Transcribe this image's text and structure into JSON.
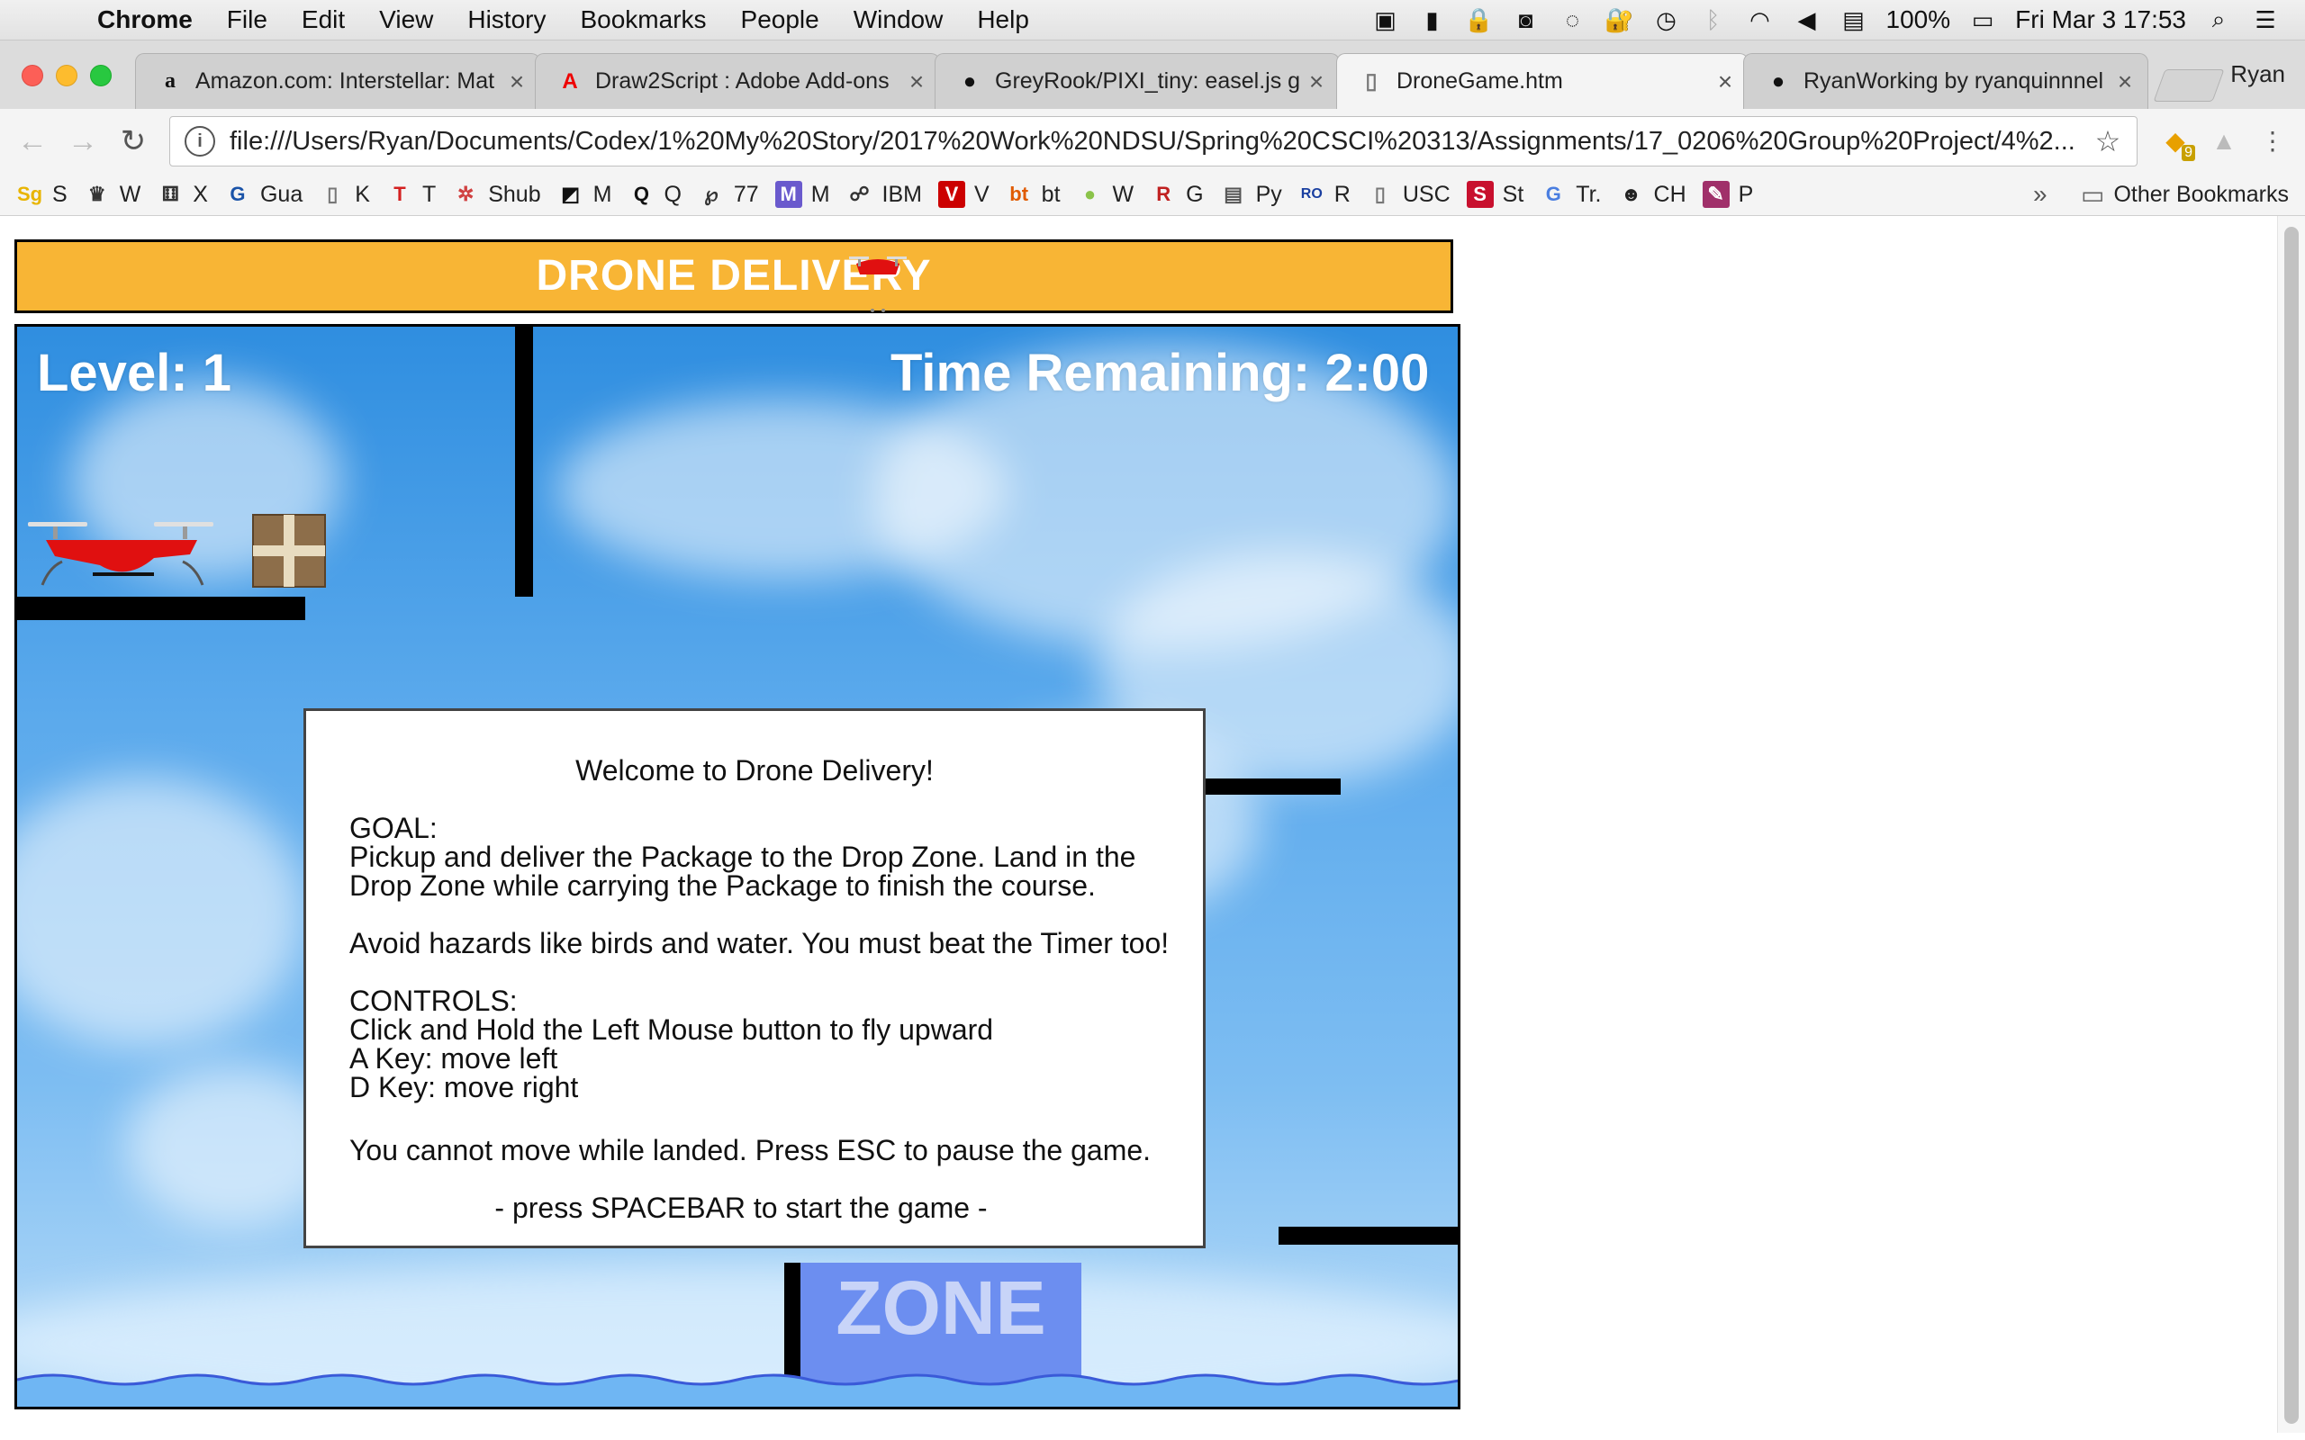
{
  "menubar": {
    "app": "Chrome",
    "items": [
      "File",
      "Edit",
      "View",
      "History",
      "Bookmarks",
      "People",
      "Window",
      "Help"
    ],
    "battery": "100%",
    "datetime": "Fri Mar 3  17:53"
  },
  "tabs": [
    {
      "title": "Amazon.com: Interstellar: Mat",
      "favicon": "amazon-icon",
      "active": false
    },
    {
      "title": "Draw2Script : Adobe Add-ons",
      "favicon": "adobe-icon",
      "active": false
    },
    {
      "title": "GreyRook/PIXI_tiny: easel.js g",
      "favicon": "github-icon",
      "active": false
    },
    {
      "title": "DroneGame.htm",
      "favicon": "page-icon",
      "active": true
    },
    {
      "title": "RyanWorking by ryanquinnnel",
      "favicon": "github-icon",
      "active": false
    }
  ],
  "profile": "Ryan",
  "toolbar": {
    "url": "file:///Users/Ryan/Documents/Codex/1%20My%20Story/2017%20Work%20NDSU/Spring%20CSCI%20313/Assignments/17_0206%20Group%20Project/4%2...",
    "extension_badge": "9"
  },
  "bookmarks": [
    {
      "icon": "Sg",
      "label": "S",
      "color": "#e8b400"
    },
    {
      "icon": "♛",
      "label": "W",
      "color": "#333"
    },
    {
      "icon": "⚅",
      "label": "X",
      "color": "#333"
    },
    {
      "icon": "G",
      "label": "Gua",
      "color": "#1a53a8"
    },
    {
      "icon": "▯",
      "label": "K",
      "color": "#777"
    },
    {
      "icon": "T",
      "label": "T",
      "color": "#d42020"
    },
    {
      "icon": "✲",
      "label": "Shub",
      "color": "#d04040"
    },
    {
      "icon": "◩",
      "label": "M",
      "color": "#111"
    },
    {
      "icon": "Q",
      "label": "Q",
      "color": "#111"
    },
    {
      "icon": "℘",
      "label": "77",
      "color": "#333"
    },
    {
      "icon": "M",
      "label": "M",
      "color": "#6a5acd"
    },
    {
      "icon": "☍",
      "label": "IBM",
      "color": "#333"
    },
    {
      "icon": "V",
      "label": "V",
      "color": "#cc0000"
    },
    {
      "icon": "bt",
      "label": "bt",
      "color": "#e05a00"
    },
    {
      "icon": "●",
      "label": "W",
      "color": "#8bc34a"
    },
    {
      "icon": "R",
      "label": "G",
      "color": "#c02020"
    },
    {
      "icon": "▤",
      "label": "Py",
      "color": "#555"
    },
    {
      "icon": "RO",
      "label": "R",
      "color": "#1a3fa0"
    },
    {
      "icon": "▯",
      "label": "USC",
      "color": "#777"
    },
    {
      "icon": "S",
      "label": "St",
      "color": "#c8102e"
    },
    {
      "icon": "G",
      "label": "Tr.",
      "color": "#4a7ee0"
    },
    {
      "icon": "☻",
      "label": "CH",
      "color": "#222"
    },
    {
      "icon": "✎",
      "label": "P",
      "color": "#a0306a"
    }
  ],
  "other_bookmarks": "Other Bookmarks",
  "game": {
    "header": "DRONE DELIVERY",
    "level": "Level: 1",
    "time": "Time Remaining: 2:00",
    "zone_label": "ZONE",
    "welcome": {
      "title": "Welcome to Drone Delivery!",
      "goal": "GOAL:\nPickup and deliver the Package to the Drop Zone. Land in the\nDrop Zone while carrying the Package to finish the course.",
      "hazards": "Avoid hazards like birds and water. You must beat the Timer too!",
      "controls": "CONTROLS:\nClick and Hold the Left Mouse button to fly upward\nA Key: move left\nD Key: move right",
      "landed": "You cannot move while landed. Press ESC to pause the game.",
      "start": "- press SPACEBAR to start the game -"
    }
  },
  "colors": {
    "header_bg": "#f8b535",
    "drone_red": "#e01010",
    "zone_blue": "#6c8ef0"
  }
}
